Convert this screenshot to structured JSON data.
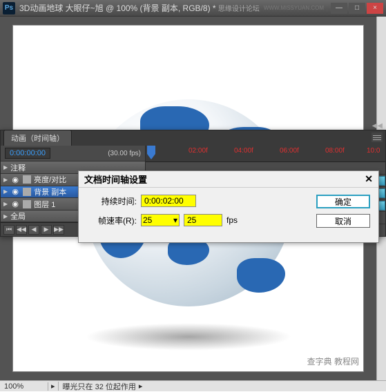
{
  "titlebar": {
    "ps_label": "Ps",
    "title": "3D动画地球   大眼仔~旭 @ 100% (背景 副本, RGB/8) *",
    "watermark_text": "思缘设计论坛",
    "watermark_url": "WWW.MISSYUAN.COM"
  },
  "window_buttons": {
    "min": "—",
    "max": "□",
    "close": "×"
  },
  "statusbar": {
    "zoom": "100%",
    "status": "曝光只在 32 位起作用"
  },
  "canvas": {
    "watermark": "查字典 教程网"
  },
  "timeline": {
    "tab_label": "动画（时间轴）",
    "current_time": "0:00:00:00",
    "fps_label": "(30.00 fps)",
    "ruler_ticks": [
      "02:00f",
      "04:00f",
      "06:00f",
      "08:00f",
      "10:0"
    ],
    "layers": [
      {
        "name": "注释",
        "icon": "note"
      },
      {
        "name": "亮度/对比",
        "icon": "adj"
      },
      {
        "name": "背景 副本",
        "icon": "layer",
        "selected": true
      },
      {
        "name": "图层 1",
        "icon": "layer"
      },
      {
        "name": "全局",
        "icon": "global"
      }
    ],
    "controls": [
      "⏮",
      "◀◀",
      "◀",
      "▶",
      "▶▶"
    ]
  },
  "dialog": {
    "title": "文档时间轴设置",
    "close": "✕",
    "duration_label": "持续时间:",
    "duration_value": "0:00:02:00",
    "framerate_label": "帧速率(R):",
    "framerate_preset": "25",
    "framerate_value": "25",
    "fps_suffix": "fps",
    "ok": "确定",
    "cancel": "取消"
  }
}
